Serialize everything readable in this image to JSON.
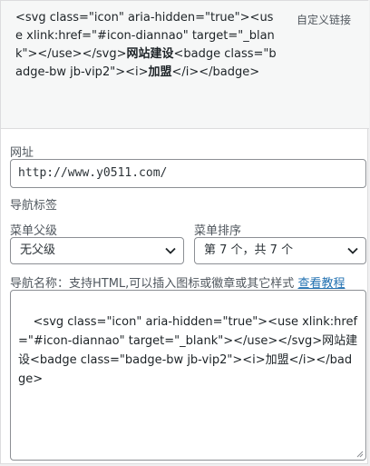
{
  "header": {
    "title_part1": "<svg class=\"icon\" aria-hidden=\"true\"><use xlink:href=\"#icon-diannao\" target=\"_blank\"></use></svg>",
    "title_bold1": "网站建设",
    "title_part2": "<badge class=\"badge-bw jb-vip2\"><i>",
    "title_bold2": "加盟",
    "title_part3": "</i></badge>",
    "item_type": "自定义链接"
  },
  "url": {
    "label": "网址",
    "value": "http://www.y0511.com/"
  },
  "nav_label": {
    "label": "导航标签"
  },
  "parent": {
    "label": "菜单父级",
    "value": "无父级"
  },
  "order": {
    "label": "菜单排序",
    "value": "第 7 个，共 7 个"
  },
  "nav_name": {
    "label": "导航名称：支持HTML,可以插入图标或徽章或其它样式 ",
    "link": "查看教程",
    "value": "<svg class=\"icon\" aria-hidden=\"true\"><use xlink:href=\"#icon-diannao\" target=\"_blank\"></use></svg>网站建设<badge class=\"badge-bw jb-vip2\"><i>加盟</i></badge>"
  }
}
